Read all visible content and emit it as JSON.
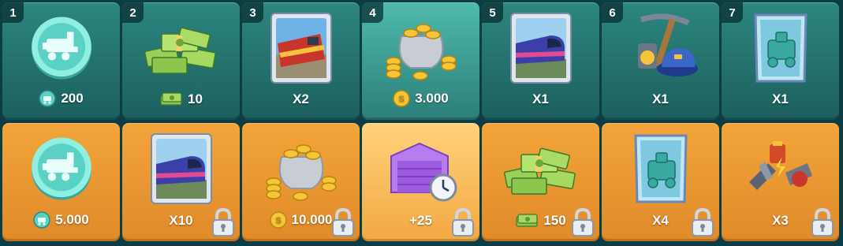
{
  "free_track": [
    {
      "tier": "1",
      "icon": "train-token-icon",
      "amount": "200",
      "amount_icon": "train-token-icon",
      "highlight": false,
      "locked": false
    },
    {
      "tier": "2",
      "icon": "cash-pile-icon",
      "amount": "10",
      "amount_icon": "cash-icon",
      "highlight": false,
      "locked": false
    },
    {
      "tier": "3",
      "icon": "diesel-train-card-icon",
      "amount": "X2",
      "amount_icon": "",
      "highlight": false,
      "locked": false
    },
    {
      "tier": "4",
      "icon": "coin-bag-icon",
      "amount": "3.000",
      "amount_icon": "coin-icon",
      "highlight": true,
      "locked": false
    },
    {
      "tier": "5",
      "icon": "passenger-train-card-icon",
      "amount": "X1",
      "amount_icon": "",
      "highlight": false,
      "locked": false
    },
    {
      "tier": "6",
      "icon": "conductor-tools-icon",
      "amount": "X1",
      "amount_icon": "",
      "highlight": false,
      "locked": false
    },
    {
      "tier": "7",
      "icon": "train-blueprint-card-icon",
      "amount": "X1",
      "amount_icon": "",
      "highlight": false,
      "locked": false
    }
  ],
  "premium_track": [
    {
      "icon": "train-token-icon",
      "amount": "5.000",
      "amount_icon": "train-token-icon",
      "highlight": false,
      "locked": false
    },
    {
      "icon": "passenger-train-card-icon",
      "amount": "X10",
      "amount_icon": "",
      "highlight": false,
      "locked": true
    },
    {
      "icon": "coin-bag-icon",
      "amount": "10.000",
      "amount_icon": "coin-icon",
      "highlight": false,
      "locked": true
    },
    {
      "icon": "garage-timer-icon",
      "amount": "+25",
      "amount_icon": "",
      "highlight": true,
      "locked": true
    },
    {
      "icon": "cash-pile-icon",
      "amount": "150",
      "amount_icon": "cash-icon",
      "highlight": false,
      "locked": true
    },
    {
      "icon": "train-blueprint-card-icon",
      "amount": "X4",
      "amount_icon": "",
      "highlight": false,
      "locked": true
    },
    {
      "icon": "tools-kit-icon",
      "amount": "X3",
      "amount_icon": "",
      "highlight": false,
      "locked": true
    }
  ],
  "colors": {
    "free": "#2d8680",
    "premium": "#f2a53a",
    "background": "#0d3d44"
  }
}
